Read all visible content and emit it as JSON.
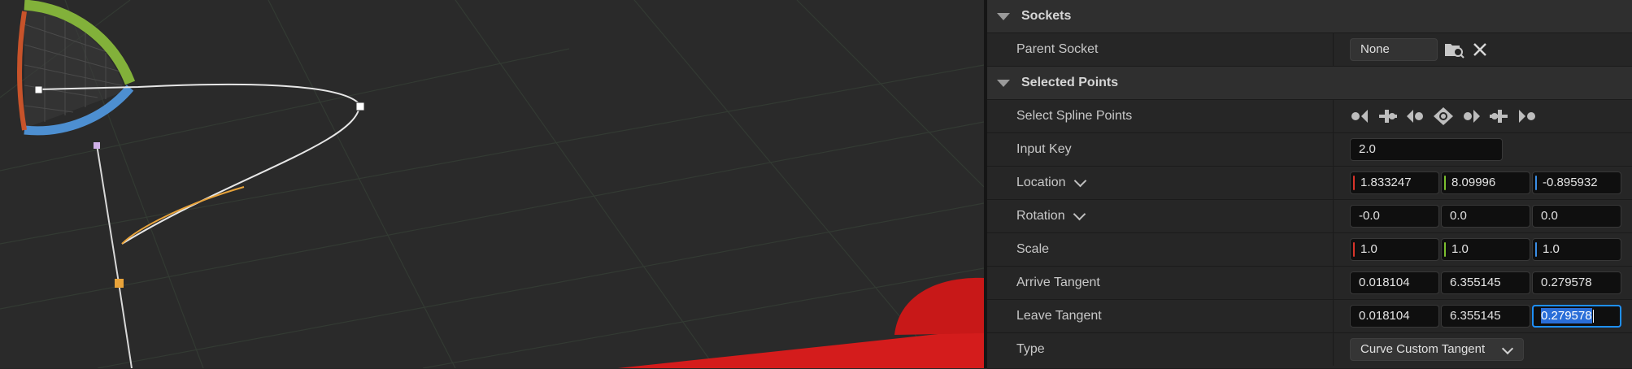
{
  "sections": {
    "sockets": {
      "title": "Sockets"
    },
    "selected_points": {
      "title": "Selected Points"
    }
  },
  "parent_socket": {
    "label": "Parent Socket",
    "value": "None"
  },
  "select_spline_points": {
    "label": "Select Spline Points",
    "icons": [
      "select-first-point-icon",
      "select-prev-point-icon",
      "add-prev-point-icon",
      "select-all-points-icon",
      "add-next-point-icon",
      "select-next-point-icon",
      "select-last-point-icon"
    ]
  },
  "input_key": {
    "label": "Input Key",
    "value": "2.0"
  },
  "location": {
    "label": "Location",
    "x": "1.833247",
    "y": "8.09996",
    "z": "-0.895932"
  },
  "rotation": {
    "label": "Rotation",
    "x": "-0.0",
    "y": "0.0",
    "z": "0.0"
  },
  "scale": {
    "label": "Scale",
    "x": "1.0",
    "y": "1.0",
    "z": "1.0"
  },
  "arrive_tangent": {
    "label": "Arrive Tangent",
    "x": "0.018104",
    "y": "6.355145",
    "z": "0.279578"
  },
  "leave_tangent": {
    "label": "Leave Tangent",
    "x": "0.018104",
    "y": "6.355145",
    "z": "0.279578"
  },
  "type": {
    "label": "Type",
    "value": "Curve Custom Tangent"
  },
  "colors": {
    "axis_x": "#d8342a",
    "axis_y": "#7cbf2f",
    "axis_z": "#3a8ee6",
    "focus": "#1e90ff",
    "spline_selected": "#e8a33a"
  }
}
